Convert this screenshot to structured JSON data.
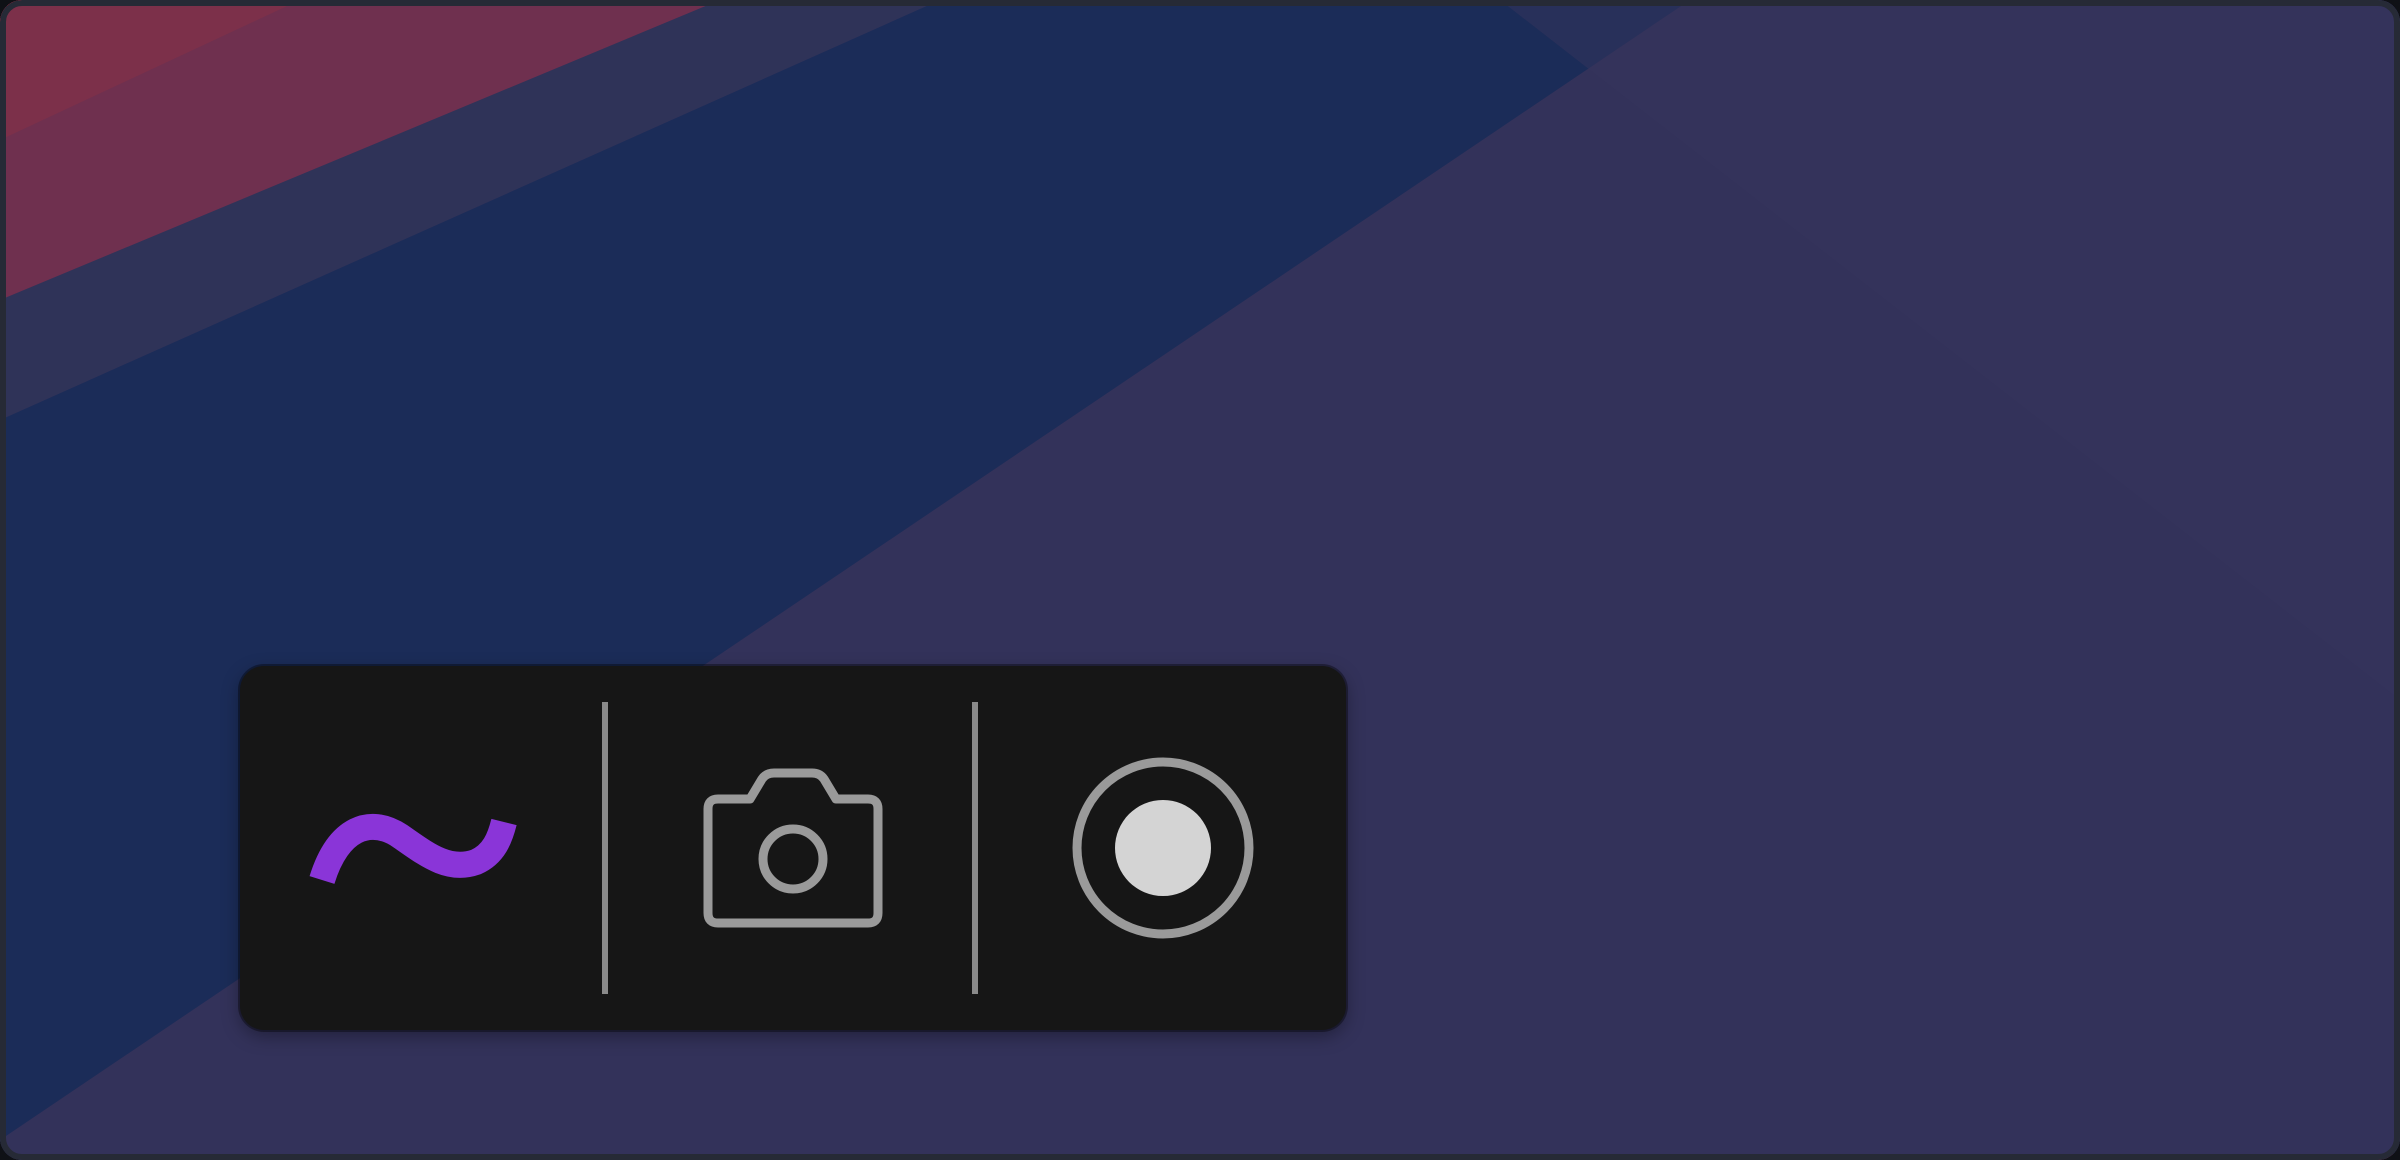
{
  "window": {
    "background_colors": {
      "base": "#33325a",
      "band_blue": "#1b2c58",
      "corner_red": "#7a2f4c",
      "frame": "#262a36",
      "accent_red": "#c01a2a"
    }
  },
  "toolbar": {
    "background": "#161616",
    "tools": [
      {
        "icon": "squiggle-icon",
        "color": "#8a35d8",
        "active": true
      },
      {
        "icon": "camera-icon",
        "color": "#9a9a9a"
      },
      {
        "icon": "record-icon",
        "color": "#9a9a9a",
        "dot_color": "#d4d4d4"
      }
    ],
    "divider_color": "#8a8a8a"
  }
}
